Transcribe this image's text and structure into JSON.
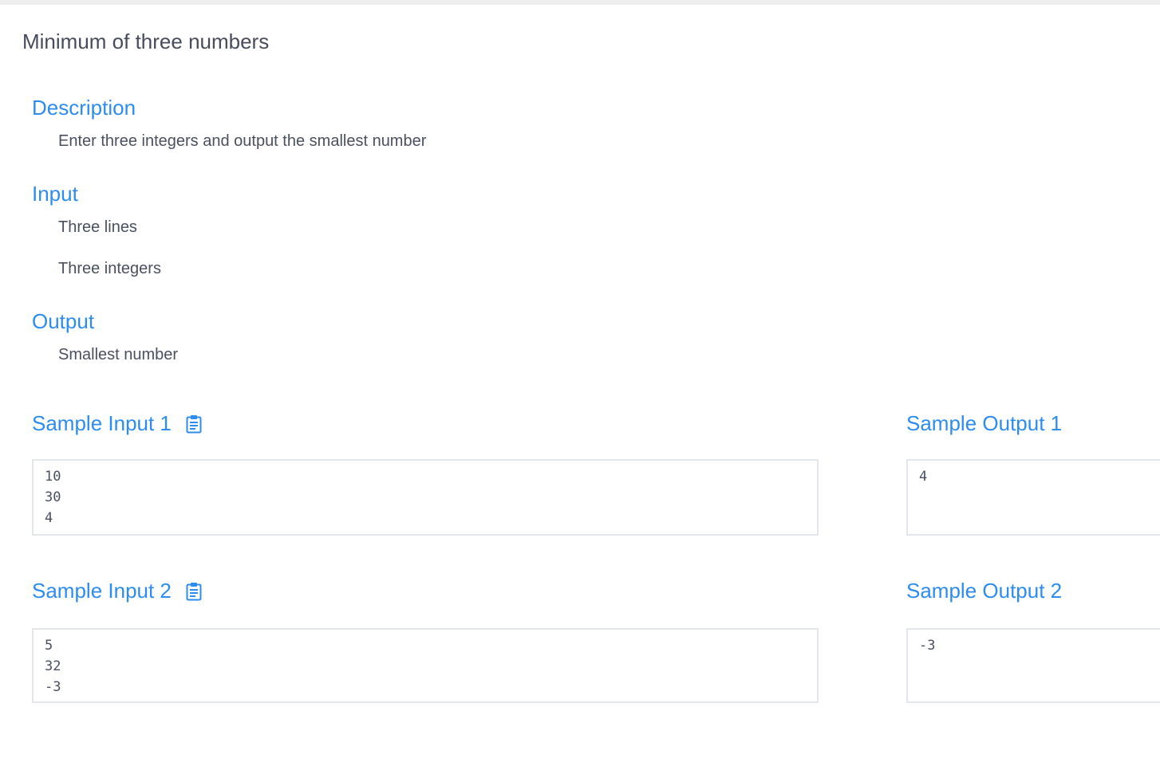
{
  "problem": {
    "title": "Minimum of three numbers"
  },
  "description": {
    "heading": "Description",
    "lines": [
      "Enter three integers and output the smallest number"
    ]
  },
  "input": {
    "heading": "Input",
    "lines": [
      "Three lines",
      "Three integers"
    ]
  },
  "output": {
    "heading": "Output",
    "lines": [
      "Smallest number"
    ]
  },
  "samples": [
    {
      "input_label": "Sample Input 1",
      "input_value": "10\n30\n4",
      "output_label": "Sample Output 1",
      "output_value": "4"
    },
    {
      "input_label": "Sample Input 2",
      "input_value": "5\n32\n-3",
      "output_label": "Sample Output 2",
      "output_value": "-3"
    }
  ],
  "icons": {
    "copy": "clipboard-icon"
  },
  "colors": {
    "accent": "#2d8cf0",
    "title": "#464c5b",
    "text": "#495060",
    "border": "#e3e6ea"
  }
}
